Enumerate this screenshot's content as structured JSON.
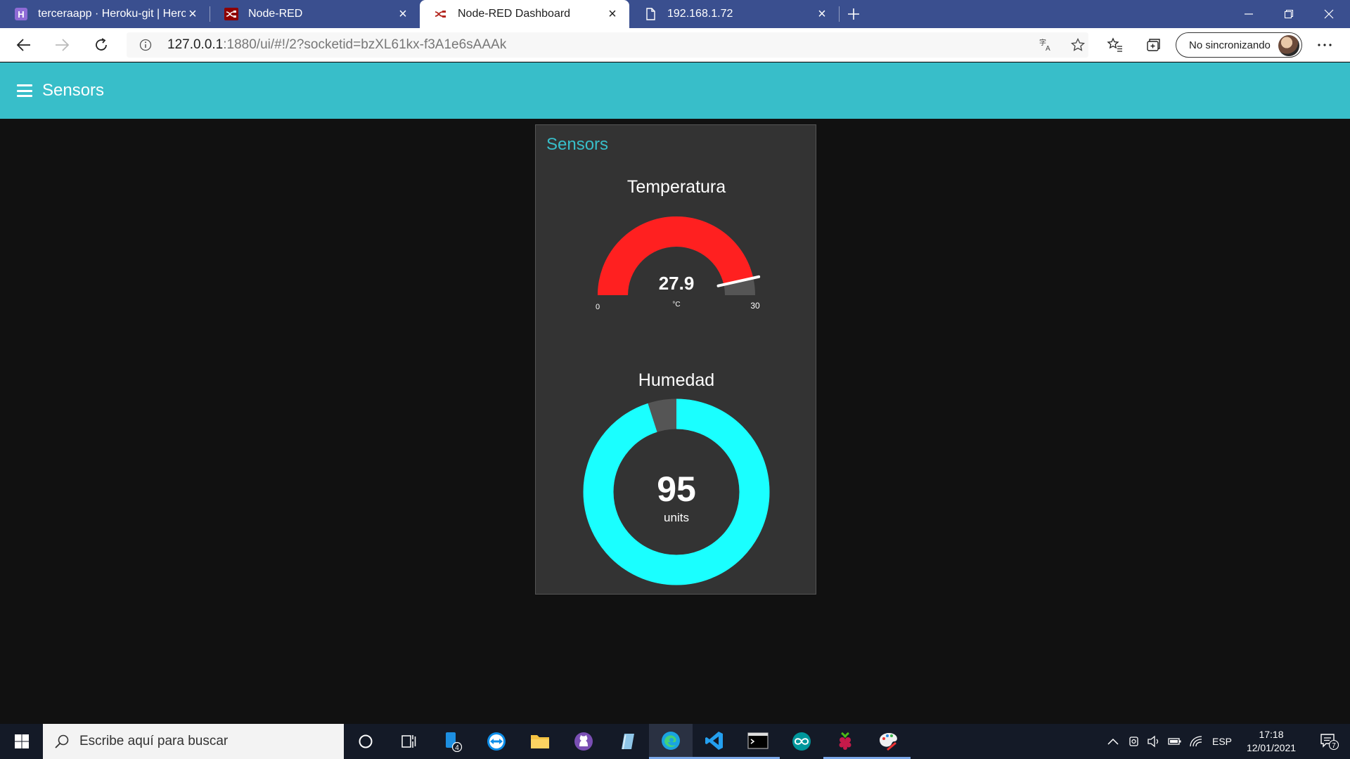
{
  "browser": {
    "tabs": [
      {
        "title": "terceraapp · Heroku-git | Heroku",
        "icon": "heroku-icon",
        "active": false
      },
      {
        "title": "Node-RED",
        "icon": "node-red-icon",
        "active": false
      },
      {
        "title": "Node-RED Dashboard",
        "icon": "node-red-icon",
        "active": true
      },
      {
        "title": "192.168.1.72",
        "icon": "page-icon",
        "active": false
      }
    ],
    "url_host": "127.0.0.1",
    "url_rest": ":1880/ui/#!/2?socketid=bzXL61kx-f3A1e6sAAAk",
    "profile_label": "No sincronizando"
  },
  "dashboard": {
    "header_title": "Sensors",
    "group_title": "Sensors",
    "accent_color": "#38bec9",
    "temperature": {
      "title": "Temperatura",
      "value": 27.9,
      "value_label": "27.9",
      "units": "°C",
      "min": 0,
      "max": 30,
      "min_label": "0",
      "max_label": "30",
      "fill_color": "#ff2020",
      "track_color": "#555555"
    },
    "humidity": {
      "title": "Humedad",
      "value": 95,
      "value_label": "95",
      "units": "units",
      "min": 0,
      "max": 100,
      "fill_color": "#1affff",
      "track_color": "#555555"
    }
  },
  "taskbar": {
    "search_placeholder": "Escribe aquí para buscar",
    "badge_count": "4",
    "language": "ESP",
    "time": "17:18",
    "date": "12/01/2021",
    "notification_count": "7"
  }
}
